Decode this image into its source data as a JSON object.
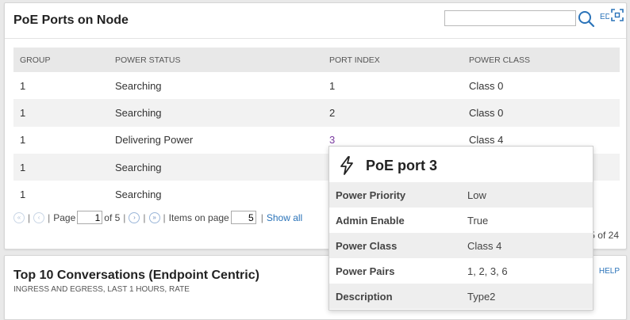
{
  "poe_panel": {
    "title": "PoE Ports on Node",
    "search_placeholder": "",
    "edit_label": "EDIT",
    "columns": [
      "GROUP",
      "POWER STATUS",
      "PORT INDEX",
      "POWER CLASS"
    ],
    "rows": [
      {
        "group": "1",
        "status": "Searching",
        "port": "1",
        "class": "Class 0"
      },
      {
        "group": "1",
        "status": "Searching",
        "port": "2",
        "class": "Class 0"
      },
      {
        "group": "1",
        "status": "Delivering Power",
        "port": "3",
        "class": "Class 4"
      },
      {
        "group": "1",
        "status": "Searching",
        "port": "",
        "class": ""
      },
      {
        "group": "1",
        "status": "Searching",
        "port": "",
        "class": ""
      }
    ],
    "pager": {
      "page_label": "Page",
      "page_value": "1",
      "of_label": "of 5",
      "items_label": "Items on page",
      "items_value": "5",
      "show_all": "Show all"
    },
    "item_count": "5 of 24"
  },
  "conversations_panel": {
    "title": "Top 10 Conversations (Endpoint Centric)",
    "subtitle": "INGRESS AND EGRESS, LAST 1 HOURS, RATE",
    "help_label": "HELP"
  },
  "tooltip": {
    "title": "PoE port 3",
    "rows": [
      {
        "key": "Power Priority",
        "value": "Low"
      },
      {
        "key": "Admin Enable",
        "value": "True"
      },
      {
        "key": "Power Class",
        "value": "Class 4"
      },
      {
        "key": "Power Pairs",
        "value": "1, 2, 3, 6"
      },
      {
        "key": "Description",
        "value": "Type2"
      }
    ]
  },
  "icons": {
    "search": "search-icon",
    "expand": "expand-icon",
    "tooltip": "lightning-bolt-icon"
  },
  "colors": {
    "link": "#2a73b9",
    "port_link": "#1f4fa8",
    "port_visited": "#7a3aa0",
    "header_bg": "#e8e8e8"
  }
}
